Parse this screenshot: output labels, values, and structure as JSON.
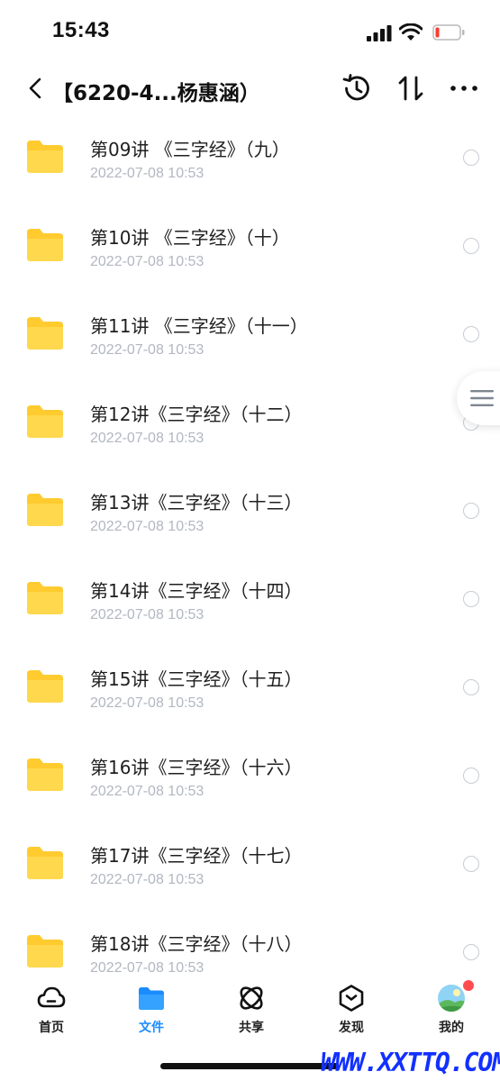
{
  "status_bar": {
    "time": "15:43"
  },
  "nav": {
    "title": "【6220-4...杨惠涵）"
  },
  "files": [
    {
      "name": "第09讲 《三字经》（九）",
      "date": "2022-07-08 10:53"
    },
    {
      "name": "第10讲 《三字经》（十）",
      "date": "2022-07-08 10:53"
    },
    {
      "name": "第11讲 《三字经》（十一）",
      "date": "2022-07-08 10:53"
    },
    {
      "name": "第12讲《三字经》（十二）",
      "date": "2022-07-08 10:53"
    },
    {
      "name": "第13讲《三字经》（十三）",
      "date": "2022-07-08 10:53"
    },
    {
      "name": "第14讲《三字经》（十四）",
      "date": "2022-07-08 10:53"
    },
    {
      "name": "第15讲《三字经》（十五）",
      "date": "2022-07-08 10:53"
    },
    {
      "name": "第16讲《三字经》（十六）",
      "date": "2022-07-08 10:53"
    },
    {
      "name": "第17讲《三字经》（十七）",
      "date": "2022-07-08 10:53"
    },
    {
      "name": "第18讲《三字经》（十八）",
      "date": "2022-07-08 10:53"
    }
  ],
  "tabs": [
    {
      "label": "首页",
      "icon": "cloud-icon",
      "active": false
    },
    {
      "label": "文件",
      "icon": "folder-icon",
      "active": true
    },
    {
      "label": "共享",
      "icon": "orbit-icon",
      "active": false
    },
    {
      "label": "发现",
      "icon": "discover-icon",
      "active": false
    },
    {
      "label": "我的",
      "icon": "avatar",
      "active": false
    }
  ],
  "watermark": "WWW.XXTTQ.COM",
  "colors": {
    "accent": "#1a8cff",
    "folder": "#ffc61a",
    "date_text": "#b2b7c0",
    "badge": "#ff4d4f",
    "watermark": "#1230ff"
  }
}
